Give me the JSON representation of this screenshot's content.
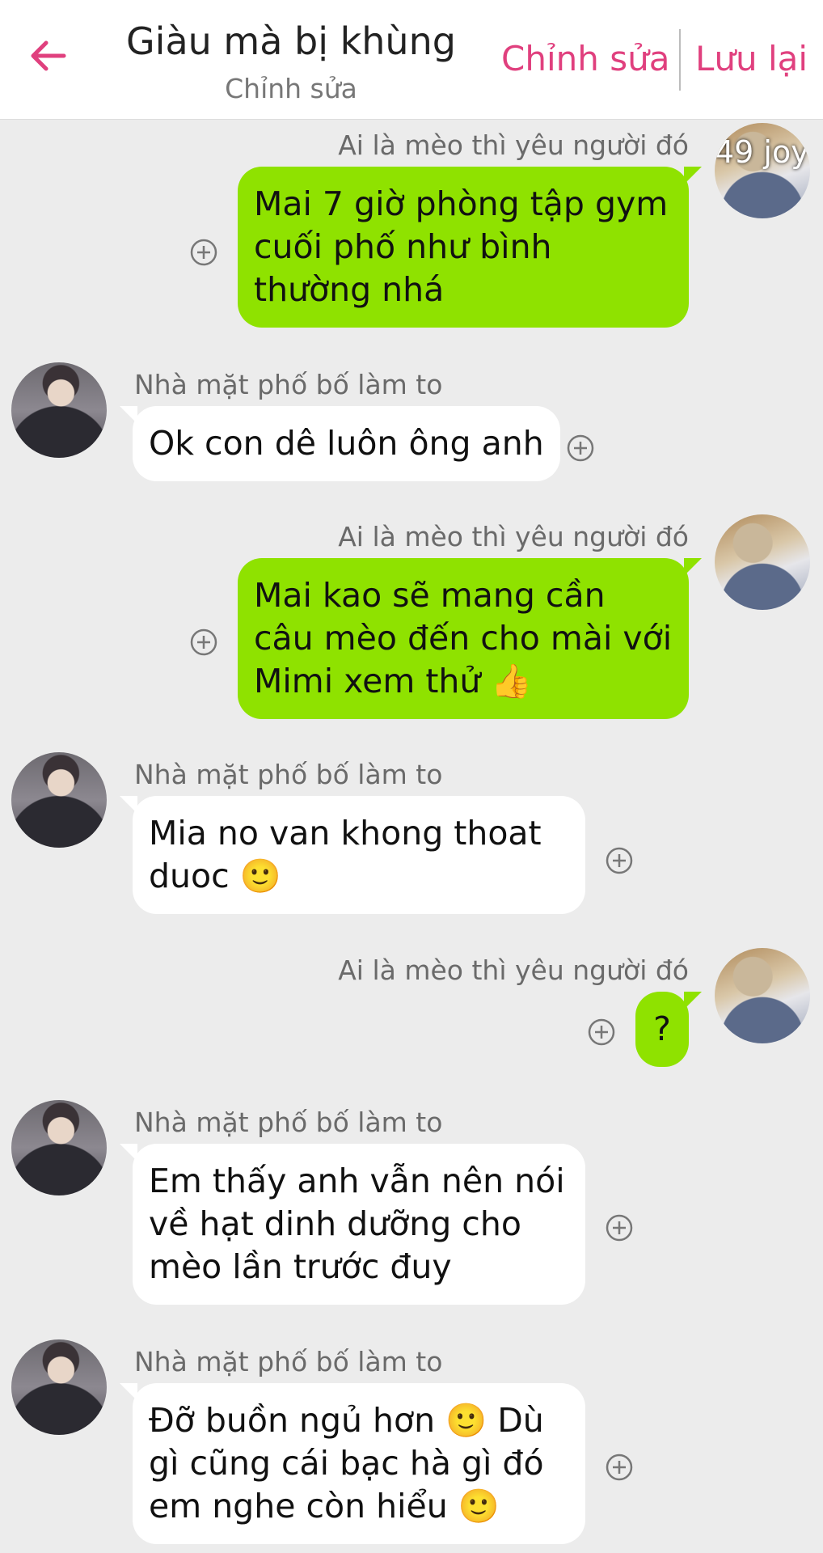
{
  "header": {
    "title": "Giàu mà bị khùng",
    "subtitle": "Chỉnh sửa",
    "edit_label": "Chỉnh sửa",
    "save_label": "Lưu lại",
    "back_icon": "arrow-left-icon",
    "accent_color": "#e0407e"
  },
  "colors": {
    "outgoing_bubble": "#8fe200",
    "incoming_bubble": "#ffffff",
    "background": "#ececec"
  },
  "messages": [
    {
      "side": "out",
      "sender": "Ai là mèo thì yêu người đó",
      "text": "Mai 7 giờ phòng tập gym cuối phố như bình thường nhá",
      "avatar_overlay": "49 joy"
    },
    {
      "side": "in",
      "sender": "Nhà mặt phố bố làm to",
      "text": "Ok con dê luôn ông anh"
    },
    {
      "side": "out",
      "sender": "Ai là mèo thì yêu người đó",
      "text": "Mai kao sẽ mang cần câu mèo đến cho mài với Mimi xem thử 👍"
    },
    {
      "side": "in",
      "sender": "Nhà mặt phố bố làm to",
      "text": "Mia no van khong thoat duoc 🙂"
    },
    {
      "side": "out",
      "sender": "Ai là mèo thì yêu người đó",
      "text": "?"
    },
    {
      "side": "in",
      "sender": "Nhà mặt phố bố làm to",
      "text": "Em thấy anh vẫn nên nói về hạt dinh dưỡng cho mèo lần trước đuy"
    },
    {
      "side": "in",
      "sender": "Nhà mặt phố bố làm to",
      "text": "Đỡ buồn ngủ hơn 🙂 Dù gì cũng cái bạc hà gì đó em nghe còn hiểu 🙂"
    }
  ]
}
